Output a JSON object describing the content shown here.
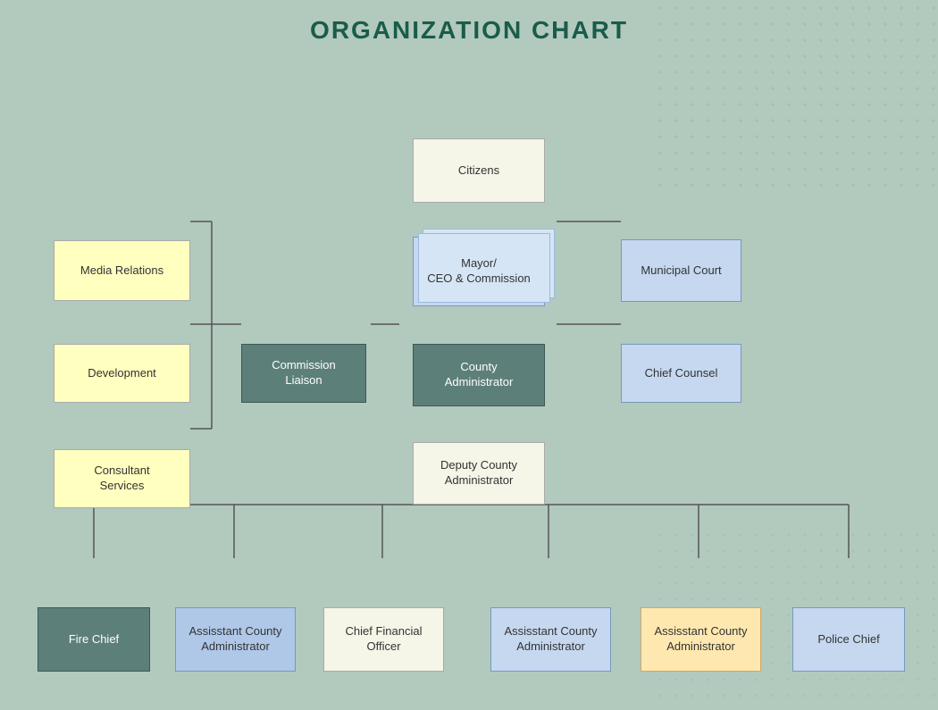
{
  "page": {
    "title": "ORGANIZATION CHART",
    "background_color": "#b2c9be"
  },
  "nodes": {
    "citizens": {
      "label": "Citizens"
    },
    "mayor": {
      "label": "Mayor/\nCEO & Commission"
    },
    "municipal_court": {
      "label": "Municipal Court"
    },
    "commission_liaison": {
      "label": "Commission\nLiaison"
    },
    "county_administrator": {
      "label": "County\nAdministrator"
    },
    "chief_counsel": {
      "label": "Chief Counsel"
    },
    "media_relations": {
      "label": "Media Relations"
    },
    "development": {
      "label": "Development"
    },
    "consultant_services": {
      "label": "Consultant\nServices"
    },
    "deputy_county_admin": {
      "label": "Deputy County\nAdministrator"
    },
    "fire_chief": {
      "label": "Fire Chief"
    },
    "asst_county_admin_1": {
      "label": "Assisstant County\nAdministrator"
    },
    "chief_financial_officer": {
      "label": "Chief Financial\nOfficer"
    },
    "asst_county_admin_2": {
      "label": "Assisstant County\nAdministrator"
    },
    "asst_county_admin_3": {
      "label": "Assisstant County\nAdministrator"
    },
    "police_chief": {
      "label": "Police Chief"
    }
  }
}
